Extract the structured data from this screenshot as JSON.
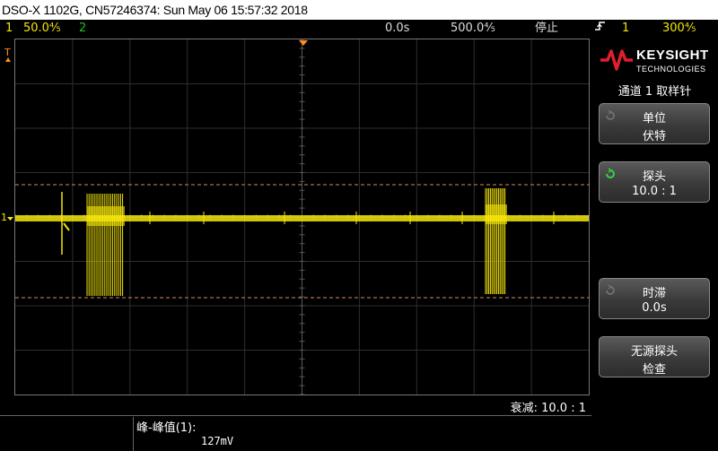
{
  "titlebar": {
    "text": "DSO-X 1102G, CN57246374: Sun May 06 15:57:32 2018"
  },
  "status": {
    "ch1_num": "1",
    "ch1_scale": "50.0⅘",
    "ch2_num": "2",
    "time_delay": "0.0s",
    "time_scale": "500.0⅘",
    "run_state": "停止",
    "trigger_icon": "rising-edge-trigger-icon",
    "trigger_ch": "1",
    "trigger_level": "300⅘"
  },
  "colors": {
    "ch1": "#f5e60a",
    "ch2": "#19c21e",
    "marker": "#ff8c1a",
    "cursor": "#d98a5a"
  },
  "panel": {
    "brand": "KEYSIGHT",
    "brand_sub": "TECHNOLOGIES",
    "menu_title": "通道 1 取样针",
    "keys": [
      {
        "line1": "单位",
        "line2": "伏特"
      },
      {
        "line1": "探头",
        "line2": "10.0 : 1"
      },
      {
        "line1": "时滞",
        "line2": "0.0s"
      },
      {
        "line1": "无源探头",
        "line2": "检查"
      }
    ]
  },
  "markers": {
    "ch1_ground": "1",
    "trigger_level": "T"
  },
  "bottom": {
    "attenuation": "衰减: 10.0 : 1",
    "measurement_name": "峰-峰值(1):",
    "measurement_value": "127mV"
  }
}
